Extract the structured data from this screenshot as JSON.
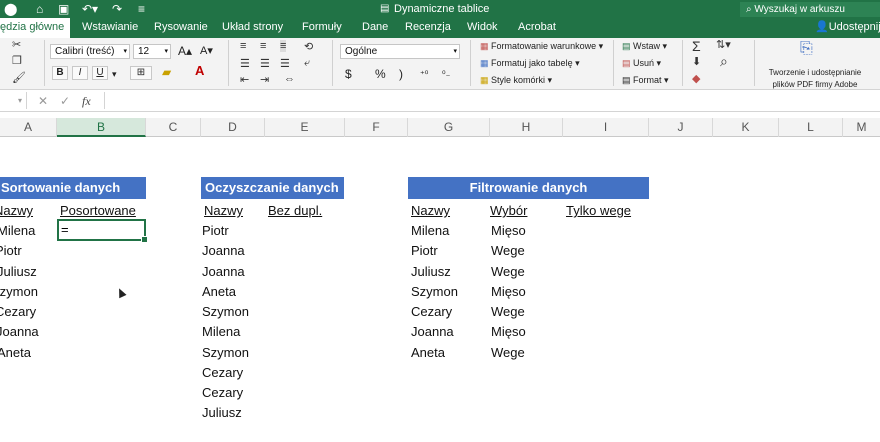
{
  "window": {
    "title": "Dynamiczne tablice",
    "search_placeholder": "Wyszukaj w arkuszu"
  },
  "ribbon_tabs": [
    {
      "label": "ędzia główne",
      "active": true
    },
    {
      "label": "Wstawianie"
    },
    {
      "label": "Rysowanie"
    },
    {
      "label": "Układ strony"
    },
    {
      "label": "Formuły"
    },
    {
      "label": "Dane"
    },
    {
      "label": "Recenzja"
    },
    {
      "label": "Widok"
    },
    {
      "label": "Acrobat"
    }
  ],
  "share_label": "Udostępnij",
  "ribbon": {
    "font_name": "Calibri (treść)",
    "font_size": "12",
    "number_format": "Ogólne",
    "conditional_formatting": "Formatowanie warunkowe",
    "format_as_table": "Formatuj jako tabelę",
    "cell_styles": "Style komórki",
    "insert": "Wstaw",
    "delete": "Usuń",
    "format": "Format",
    "pdf_line1": "Tworzenie i udostępnianie",
    "pdf_line2": "plików PDF firmy Adobe",
    "bold": "B",
    "italic": "I",
    "underline": "U",
    "grow_font": "A",
    "shrink_font": "A",
    "currency": "$",
    "percent": "%",
    "comma": ")"
  },
  "formula_bar": {
    "fx": "fx",
    "cancel": "✕",
    "enter": "✓"
  },
  "columns": [
    "A",
    "B",
    "C",
    "D",
    "E",
    "F",
    "G",
    "H",
    "I",
    "J",
    "K",
    "L",
    "M"
  ],
  "sheet": {
    "sort": {
      "title": "Sortowanie danych",
      "col1_header": "Nazwy",
      "col2_header": "Posortowane",
      "names": [
        "Milena",
        "Piotr",
        "Juliusz",
        "Szymon",
        "Cezary",
        "Joanna",
        "Aneta"
      ],
      "active_cell_value": "="
    },
    "clean": {
      "title": "Oczyszczanie danych",
      "col1_header": "Nazwy",
      "col2_header": "Bez dupl.",
      "names": [
        "Piotr",
        "Joanna",
        "Joanna",
        "Aneta",
        "Szymon",
        "Milena",
        "Szymon",
        "Cezary",
        "Cezary",
        "Juliusz"
      ]
    },
    "filter": {
      "title": "Filtrowanie danych",
      "col1_header": "Nazwy",
      "col2_header": "Wybór",
      "col3_header": "Tylko wege",
      "names": [
        "Milena",
        "Piotr",
        "Juliusz",
        "Szymon",
        "Cezary",
        "Joanna",
        "Aneta"
      ],
      "choices": [
        "Mięso",
        "Wege",
        "Wege",
        "Mięso",
        "Wege",
        "Mięso",
        "Wege"
      ]
    }
  }
}
